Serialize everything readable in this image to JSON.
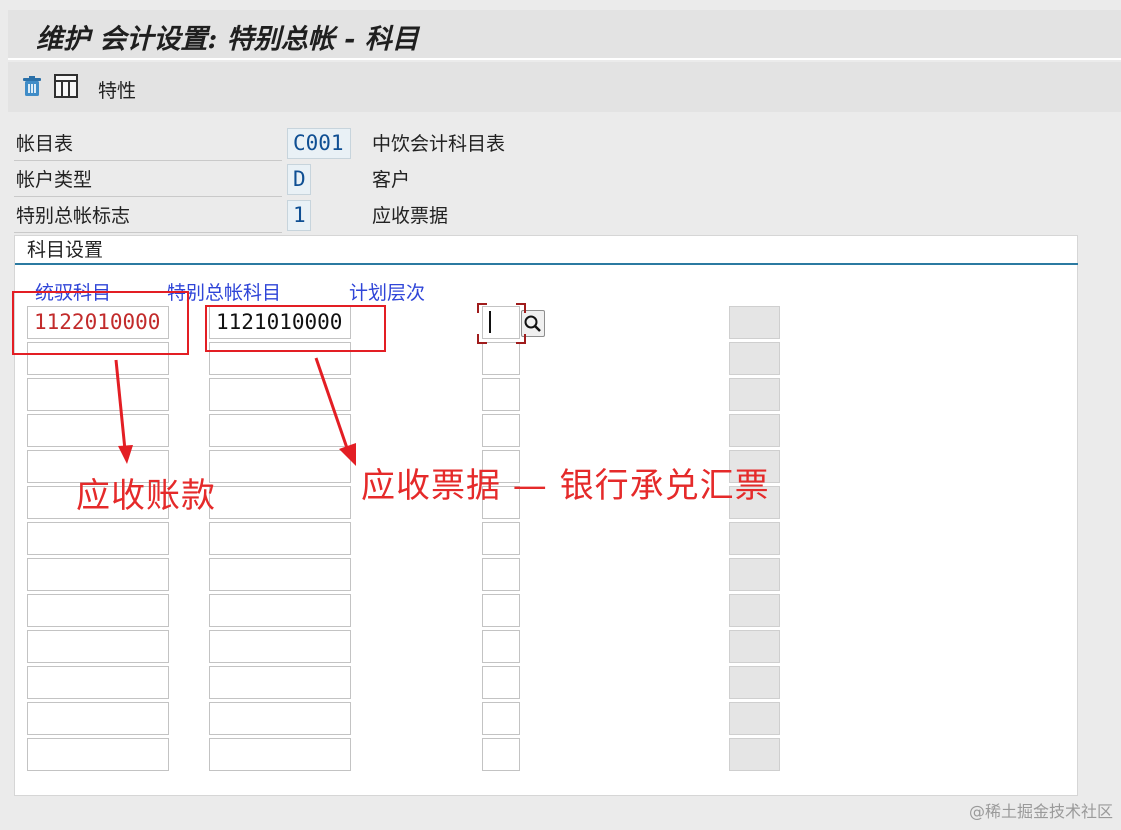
{
  "title": "维护 会计设置: 特别总帐 - 科目",
  "toolbar": {
    "delete_icon": "trash-icon",
    "grid_icon": "table-grid-icon",
    "properties_label": "特性"
  },
  "header_rows": [
    {
      "label": "帐目表",
      "code": "C001",
      "desc": "中饮会计科目表"
    },
    {
      "label": "帐户类型",
      "code": "D",
      "desc": "客户"
    },
    {
      "label": "特别总帐标志",
      "code": "1",
      "desc": "应收票据"
    }
  ],
  "panel": {
    "title": "科目设置",
    "columns": {
      "recon_account": "统驭科目",
      "special_gl_account": "特别总帐科目",
      "planning_level": "计划层次"
    },
    "first_row": {
      "recon_account": "1122010000",
      "special_gl_account": "1121010000"
    }
  },
  "annotations": {
    "left_note": "应收账款",
    "right_note": "应收票据 — 银行承兑汇票"
  },
  "watermark": "@稀土掘金技术社区",
  "colors": {
    "annotation_red": "#e31e24",
    "column_header_blue": "#2f45d8",
    "code_blue": "#0f4f93"
  }
}
